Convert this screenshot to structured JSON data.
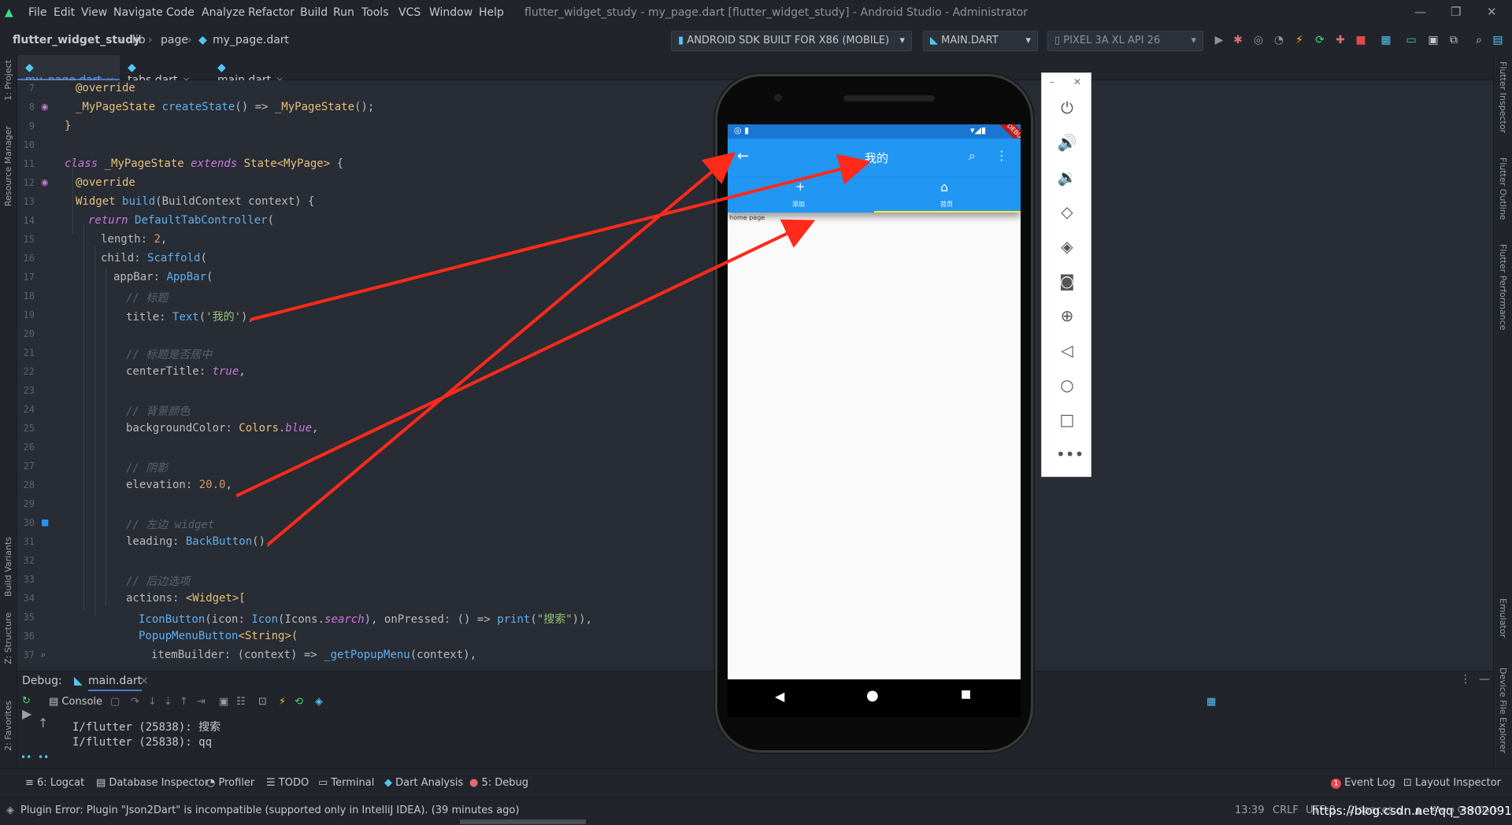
{
  "app": {
    "window_title": "flutter_widget_study - my_page.dart [flutter_widget_study] - Android Studio - Administrator",
    "menu": [
      "File",
      "Edit",
      "View",
      "Navigate",
      "Code",
      "Analyze",
      "Refactor",
      "Build",
      "Run",
      "Tools",
      "VCS",
      "Window",
      "Help"
    ]
  },
  "breadcrumb": [
    "flutter_widget_study",
    "lib",
    "page",
    "my_page.dart"
  ],
  "toolbar": {
    "device": "ANDROID SDK BUILT FOR X86 (MOBILE)",
    "run_config": "MAIN.DART",
    "emulator": "PIXEL 3A XL API 26"
  },
  "left_tools": [
    "1: Project",
    "Resource Manager",
    "Build Variants",
    "Z: Structure",
    "2: Favorites"
  ],
  "right_tools": [
    "Flutter Inspector",
    "Flutter Outline",
    "Flutter Performance",
    "Emulator",
    "Device File Explorer"
  ],
  "editor_tabs": [
    {
      "label": "my_page.dart",
      "active": true
    },
    {
      "label": "tabs.dart",
      "active": false
    },
    {
      "label": "main.dart",
      "active": false
    }
  ],
  "line_numbers": [
    "7",
    "8",
    "9",
    "10",
    "11",
    "12",
    "13",
    "14",
    "15",
    "16",
    "17",
    "18",
    "19",
    "20",
    "21",
    "22",
    "23",
    "24",
    "25",
    "26",
    "27",
    "28",
    "29",
    "30",
    "31",
    "32",
    "33",
    "34",
    "35",
    "36",
    "37"
  ],
  "code": {
    "l7_ann": "@override",
    "l8_a": "_MyPageState ",
    "l8_b": "createState",
    "l8_c": "() => ",
    "l8_d": "_MyPageState",
    "l8_e": "();",
    "l9": "}",
    "l11_kw": "class ",
    "l11_a": "_MyPageState ",
    "l11_kw2": "extends ",
    "l11_b": "State<MyPage>",
    "l11_c": " {",
    "l12_ann": "@override",
    "l13_a": "Widget ",
    "l13_b": "build",
    "l13_c": "(BuildContext context) {",
    "l14_kw": "return ",
    "l14_a": "DefaultTabController",
    "l14_b": "(",
    "l15_a": "length: ",
    "l15_n": "2",
    "l15_b": ",",
    "l16_a": "child: ",
    "l16_b": "Scaffold",
    "l16_c": "(",
    "l17_a": "appBar: ",
    "l17_b": "AppBar",
    "l17_c": "(",
    "l18_cmt": "// 标题",
    "l19_a": "title: ",
    "l19_b": "Text",
    "l19_c": "(",
    "l19_s": "'我的'",
    "l19_d": "),",
    "l21_cmt": "// 标题是否居中",
    "l22_a": "centerTitle: ",
    "l22_kw": "true",
    "l22_b": ",",
    "l24_cmt": "// 背景颜色",
    "l25_a": "backgroundColor: ",
    "l25_b": "Colors",
    "l25_c": ".",
    "l25_d": "blue",
    "l25_e": ",",
    "l27_cmt": "// 阴影",
    "l28_a": "elevation: ",
    "l28_n": "20.0",
    "l28_b": ",",
    "l30_cmt": "// 左边 widget",
    "l31_a": "leading: ",
    "l31_b": "BackButton",
    "l31_c": "(),",
    "l33_cmt": "// 后边选项",
    "l34_a": "actions: ",
    "l34_b": "<Widget>[",
    "l35_a": "IconButton",
    "l35_b": "(icon: ",
    "l35_c": "Icon",
    "l35_d": "(Icons.",
    "l35_e": "search",
    "l35_f": "), onPressed: () => ",
    "l35_g": "print",
    "l35_h": "(",
    "l35_s": "\"搜索\"",
    "l35_i": ")),",
    "l36_a": "PopupMenuButton",
    "l36_b": "<String>(",
    "l37_a": "itemBuilder: (context) => ",
    "l37_b": "_getPopupMenu",
    "l37_c": "(context),"
  },
  "debug": {
    "label": "Debug:",
    "tab": "main.dart",
    "console": "Console",
    "logs": [
      "I/flutter (25838): 搜索",
      "I/flutter (25838): qq"
    ]
  },
  "bottom_tabs": [
    "6: Logcat",
    "Database Inspector",
    "Profiler",
    "TODO",
    "Terminal",
    "Dart Analysis",
    "5: Debug"
  ],
  "bottom_right": [
    "Event Log",
    "Layout Inspector"
  ],
  "event_badge": "1",
  "status": {
    "message": "Plugin Error: Plugin \"Json2Dart\" is incompatible (supported only in IntelliJ IDEA). (39 minutes ago)",
    "position": "13:39",
    "line_sep": "CRLF",
    "encoding": "UTF-8",
    "indent": "2 spaces",
    "theme": "Atom One Dark",
    "watermark": "https://blog.csdn.net/qq_38020915"
  },
  "phone": {
    "title": "我的",
    "tab_add": "添加",
    "tab_home": "首页",
    "body_text": "home page",
    "debug_banner": "DEBUG"
  },
  "colors": {
    "appbar": "#2196f3",
    "arrow": "#ff2a1a",
    "editor_bg": "#282c34"
  }
}
